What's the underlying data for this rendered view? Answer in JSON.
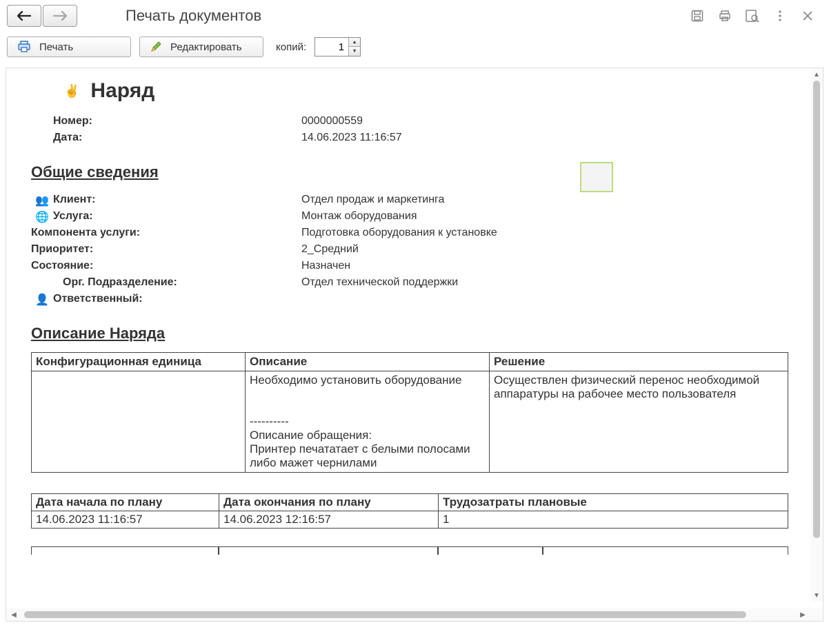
{
  "titlebar": {
    "title": "Печать документов"
  },
  "toolbar": {
    "print_label": "Печать",
    "edit_label": "Редактировать",
    "copies_label": "копий:",
    "copies_value": "1"
  },
  "document": {
    "heading": "Наряд",
    "number_label": "Номер:",
    "number_value": "0000000559",
    "date_label": "Дата:",
    "date_value": "14.06.2023 11:16:57",
    "section_general": "Общие сведения",
    "client_label": "Клиент:",
    "client_value": "Отдел продаж и маркетинга",
    "service_label": "Услуга:",
    "service_value": "Монтаж оборудования",
    "component_label": "Компонента услуги:",
    "component_value": "Подготовка оборудования к установке",
    "priority_label": "Приоритет:",
    "priority_value": "2_Средний",
    "state_label": "Состояние:",
    "state_value": "Назначен",
    "org_label": "Орг. Подразделение:",
    "org_value": "Отдел технической поддержки",
    "resp_label": "Ответственный:",
    "resp_value": "",
    "section_desc": "Описание Наряда",
    "table1": {
      "h1": "Конфигурационная единица",
      "h2": "Описание",
      "h3": "Решение",
      "r1c1": "",
      "r1c2": "Необходимо установить оборудование\n\n\n----------\nОписание обращения:\nПринтер печататает с белыми полосами либо мажет чернилами",
      "r1c3": "Осуществлен физический перенос необходимой аппаратуры на рабочее место пользователя"
    },
    "table2": {
      "h1": "Дата начала по плану",
      "h2": "Дата окончания по плану",
      "h3": "Трудозатраты плановые",
      "r1c1": "14.06.2023 11:16:57",
      "r1c2": "14.06.2023 12:16:57",
      "r1c3": "1"
    }
  }
}
